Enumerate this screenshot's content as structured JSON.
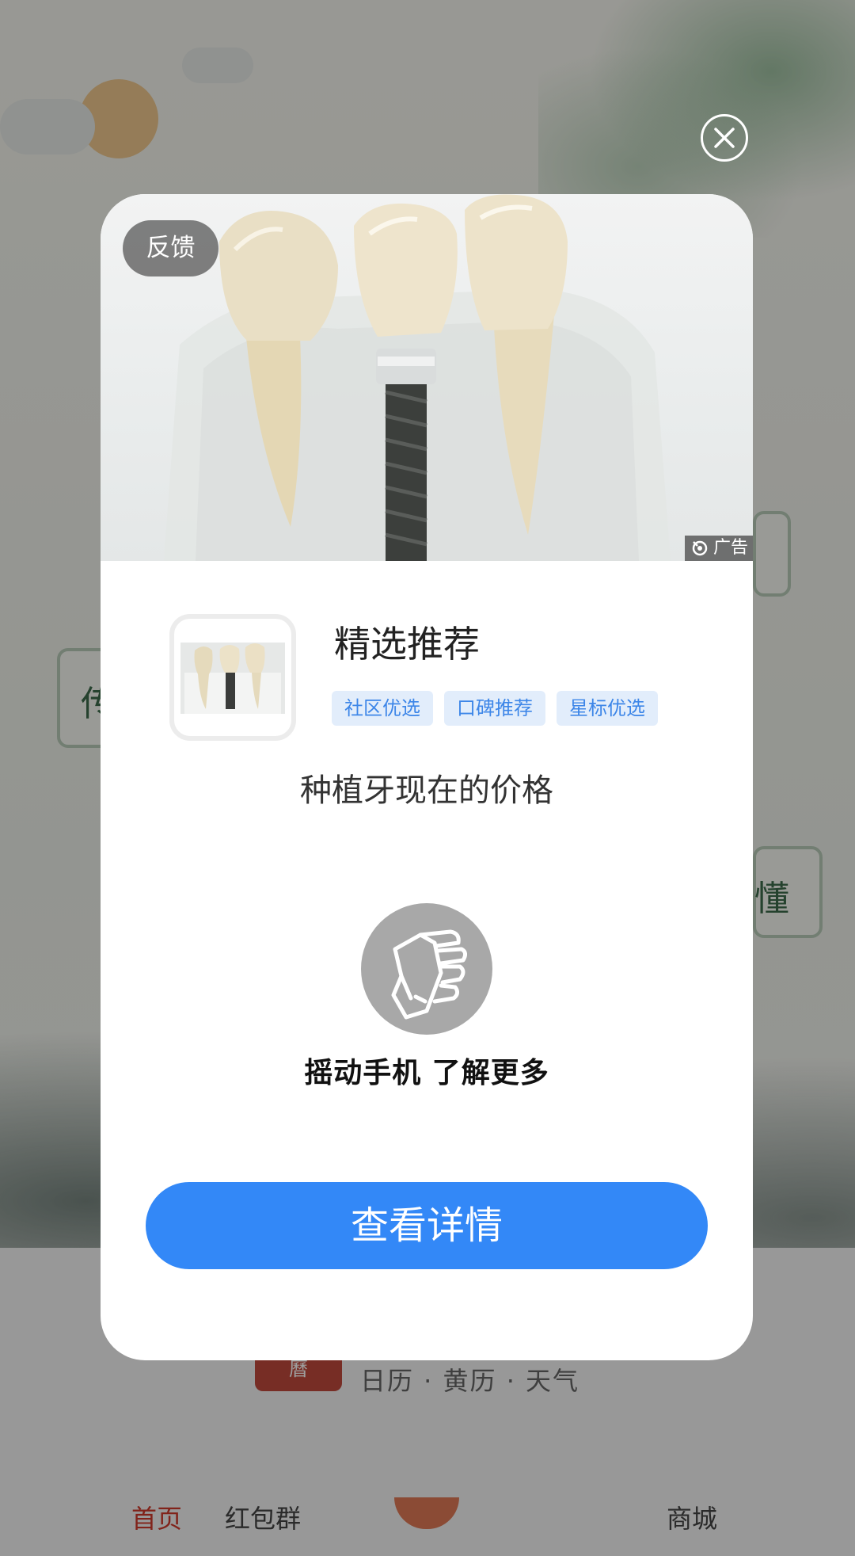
{
  "background": {
    "card_left_char": "传",
    "card_right_char": "懂",
    "logo_char": "曆",
    "tagline": "日历 · 黄历 · 天气",
    "nav": [
      "首页",
      "红包群",
      "",
      "商城"
    ]
  },
  "modal": {
    "feedback_label": "反馈",
    "ad_label": "广告",
    "title": "精选推荐",
    "tags": [
      "社区优选",
      "口碑推荐",
      "星标优选"
    ],
    "description": "种植牙现在的价格",
    "shake_prompt": "摇动手机  了解更多",
    "cta_label": "查看详情"
  },
  "colors": {
    "accent": "#3388f7",
    "tag_bg": "#e2edfb",
    "tag_text": "#3d86e8",
    "dim_overlay": "rgba(0,0,0,0.38)"
  },
  "icons": {
    "close": "close-icon",
    "ad": "ad-eye-icon",
    "shake": "shake-phone-hand-icon"
  }
}
